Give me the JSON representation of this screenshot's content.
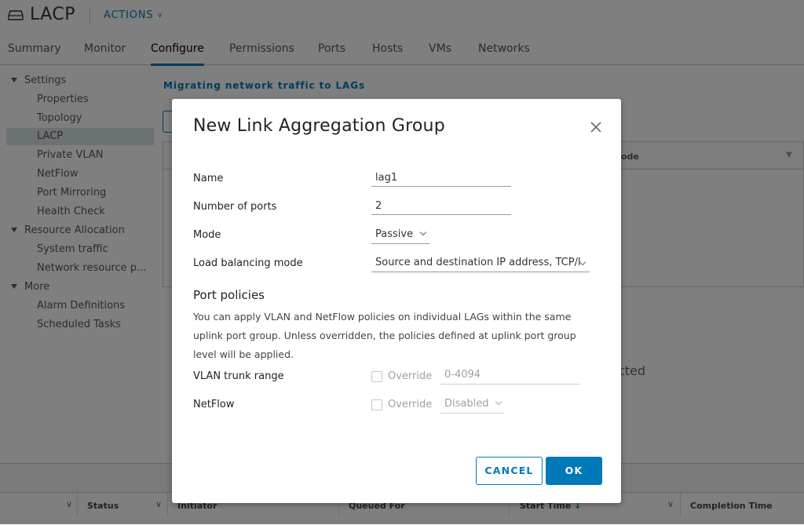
{
  "header": {
    "title": "LACP",
    "actions_label": "ACTIONS"
  },
  "tabs": [
    "Summary",
    "Monitor",
    "Configure",
    "Permissions",
    "Ports",
    "Hosts",
    "VMs",
    "Networks"
  ],
  "active_tab": "Configure",
  "sidebar": {
    "settings": "Settings",
    "properties": "Properties",
    "topology": "Topology",
    "lacp": "LACP",
    "private_vlan": "Private VLAN",
    "netflow": "NetFlow",
    "port_mirroring": "Port Mirroring",
    "health_check": "Health Check",
    "resource_allocation": "Resource Allocation",
    "system_traffic": "System traffic",
    "network_resource": "Network resource p...",
    "more": "More",
    "alarm_definitions": "Alarm Definitions",
    "scheduled_tasks": "Scheduled Tasks"
  },
  "content": {
    "title": "Migrating network traffic to LAGs",
    "grid_header_fragment": "ode",
    "empty_fragment": "cted"
  },
  "bottom_table": {
    "headers": [
      "Status",
      "Initiator",
      "Queued For",
      "Start Time",
      "Completion Time"
    ]
  },
  "modal": {
    "title": "New Link Aggregation Group",
    "name_label": "Name",
    "name_value": "lag1",
    "ports_label": "Number of ports",
    "ports_value": "2",
    "mode_label": "Mode",
    "mode_value": "Passive",
    "lb_label": "Load balancing mode",
    "lb_value": "Source and destination IP address, TCP/l",
    "port_policies_title": "Port policies",
    "port_policies_desc": "You can apply VLAN and NetFlow policies on individual LAGs within the same uplink port group. Unless overridden, the policies defined at uplink port group level will be applied.",
    "vlan_label": "VLAN trunk range",
    "vlan_override": "Override",
    "vlan_value": "0-4094",
    "netflow_label": "NetFlow",
    "netflow_override": "Override",
    "netflow_value": "Disabled",
    "cancel_label": "CANCEL",
    "ok_label": "OK"
  },
  "colors": {
    "accent": "#0079b8",
    "overlay": "rgba(0,0,0,0.5)",
    "selected_bg": "#d8e3e9"
  }
}
